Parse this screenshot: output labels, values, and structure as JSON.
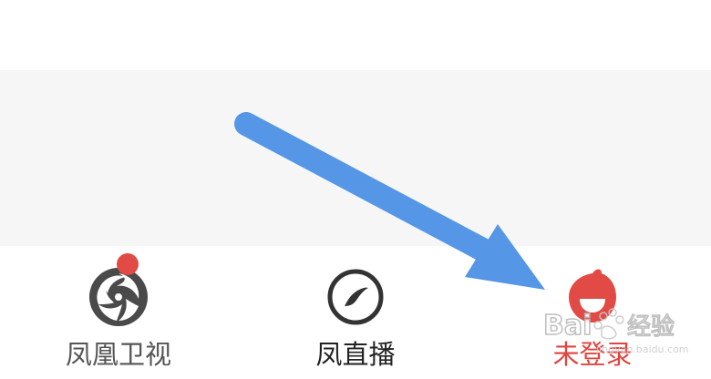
{
  "tab_bar": {
    "tabs": [
      {
        "label": "凤凰卫视",
        "icon": "phoenix-logo-icon",
        "has_badge": true
      },
      {
        "label": "凤直播",
        "icon": "live-leaf-icon"
      },
      {
        "label": "未登录",
        "icon": "user-avatar-icon",
        "active": true
      }
    ]
  },
  "watermark": {
    "text": "Bai 经验",
    "sub": "jingyan.baidu.com"
  },
  "colors": {
    "accent": "#e0443e",
    "badge": "#e24a46",
    "arrow": "#5596e6",
    "content_bg": "#f6f6f7"
  }
}
